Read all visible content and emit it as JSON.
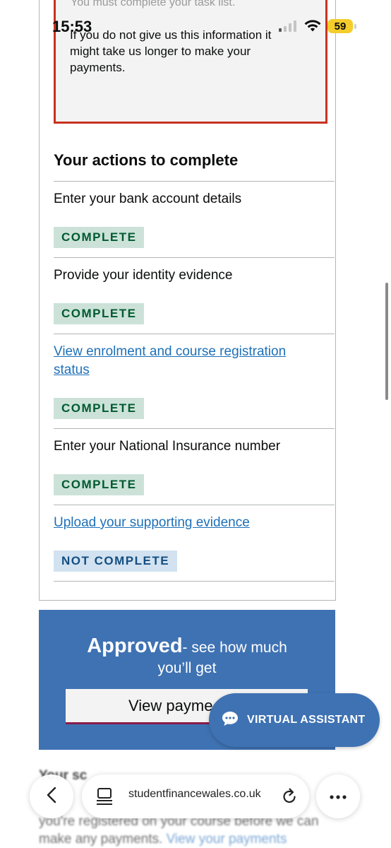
{
  "status_bar": {
    "time": "15:53",
    "battery": "59"
  },
  "warning": {
    "top_line": "You must complete your task list.",
    "message": "If you do not give us this information it might take us longer to make your payments."
  },
  "actions": {
    "heading": "Your actions to complete",
    "items": [
      {
        "label": "Enter your bank account details",
        "status": "COMPLETE"
      },
      {
        "label": "Provide your identity evidence",
        "status": "COMPLETE"
      },
      {
        "label": "View enrolment and course registration status",
        "status": "COMPLETE"
      },
      {
        "label": "Enter your National Insurance number",
        "status": "COMPLETE"
      },
      {
        "label": "Upload your supporting evidence",
        "status": "NOT COMPLETE"
      }
    ]
  },
  "approved": {
    "title": "Approved",
    "subtitle": "- see how much you’ll get",
    "button_label": "View payme"
  },
  "virtual_assistant": {
    "label": "VIRTUAL ASSISTANT"
  },
  "below_fold": {
    "heading": "Your sc",
    "text": "you're registered on your course before we can make any payments.",
    "link": "View your payments"
  },
  "browser": {
    "url": "studentfinancewales.co.uk"
  },
  "colors": {
    "link": "#1d70b8",
    "complete_bg": "#cce2d8",
    "complete_fg": "#005a30",
    "incomplete_bg": "#d2e2f1",
    "panel": "#3f72b3",
    "warning_border": "#c8321f"
  }
}
